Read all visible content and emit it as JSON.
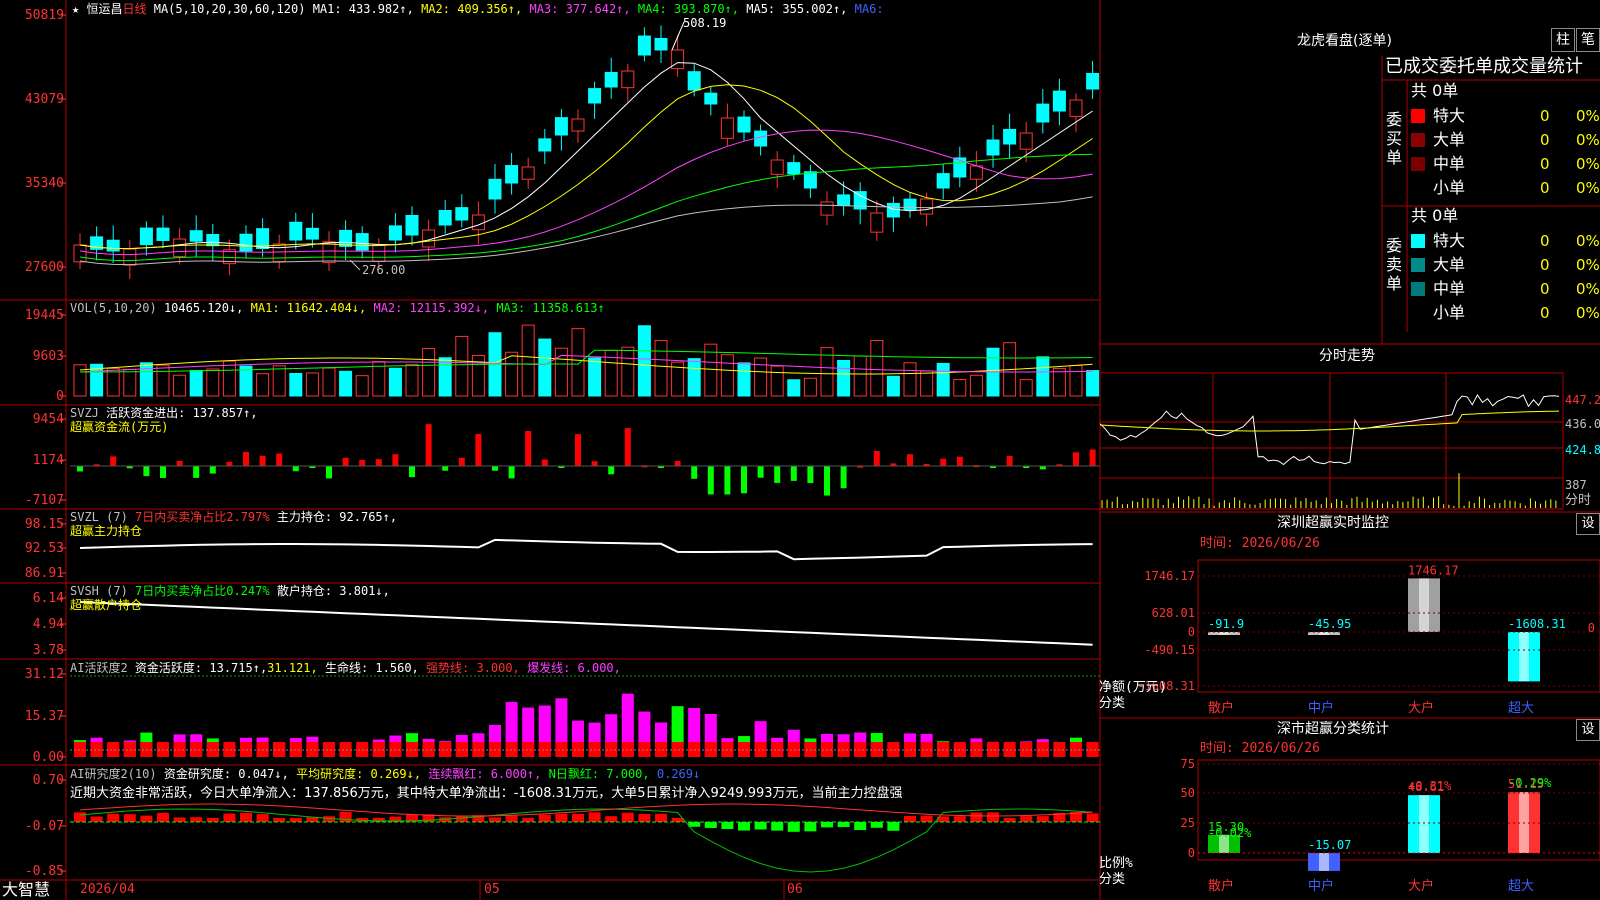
{
  "header": {
    "star": "★",
    "stock": "恒运昌",
    "period": "日线",
    "ma_title": "MA(5,10,20,30,60,120)",
    "ma1": "MA1: 433.982↑,",
    "ma2": "MA2: 409.356↑,",
    "ma3": "MA3: 377.642↑,",
    "ma4": "MA4: 393.870↑,",
    "ma5": "MA5: 355.002↑,",
    "ma6": "MA6:"
  },
  "price_axis": [
    "50819",
    "43079",
    "35340",
    "27600"
  ],
  "price_marks": {
    "high": "508.19",
    "low": "276.00"
  },
  "vol": {
    "title": "VOL(5,10,20)",
    "val": "10465.120↓,",
    "ma1": "MA1: 11642.404↓,",
    "ma2": "MA2: 12115.392↓,",
    "ma3": "MA3: 11358.613↑",
    "axis": [
      "19445",
      "9603",
      "0"
    ]
  },
  "svzj": {
    "title": "SVZJ",
    "label": "活跃资金进出: 137.857↑,",
    "sub": "超赢资金流(万元)",
    "axis": [
      "9454",
      "1174",
      "-7107"
    ]
  },
  "svzl": {
    "title": "SVZL (7)",
    "ratio": "7日内买卖净占比2.797%",
    "hold": "主力持仓: 92.765↑,",
    "sub": "超赢主力持仓",
    "axis": [
      "98.15",
      "92.53",
      "86.91"
    ]
  },
  "svsh": {
    "title": "SVSH (7)",
    "ratio": "7日内买卖净占比0.247%",
    "hold": "散户持仓: 3.801↓,",
    "sub": "超赢散户持仓",
    "axis": [
      "6.14",
      "4.94",
      "3.78"
    ]
  },
  "ai1": {
    "title": "AI活跃度2",
    "act": "资金活跃度: 13.715↑,",
    "v2": "31.121,",
    "life": "生命线: 1.560,",
    "strong": "强势线: 3.000,",
    "burst": "爆发线: 6.000,",
    "axis": [
      "31.12",
      "15.37",
      "0.00"
    ]
  },
  "ai2": {
    "title": "AI研究度2(10)",
    "res": "资金研究度: 0.047↓,",
    "avg": "平均研究度: 0.269↓,",
    "cont": "连续飘红: 6.000↑,",
    "nday": "N日飘红: 7.000,",
    "v5": "0.269↓",
    "summary": "近期大资金非常活跃，今日大单净流入：137.856万元，其中特大单净流出：-1608.31万元，大单5日累计净入9249.993万元，当前主力控盘强",
    "axis": [
      "0.70",
      "-0.07",
      "-0.85"
    ]
  },
  "bottom": {
    "brand": "大智慧",
    "date": "2026/04",
    "m5": "05",
    "m6": "06"
  },
  "dragon": {
    "title": "龙虎看盘(逐单)",
    "btn1": "柱",
    "btn2": "笔",
    "tab": "已成交委托单成交量统计",
    "buy_label": "委买单",
    "sell_label": "委卖单",
    "buy_total": "共 0单",
    "sell_total": "共 0单",
    "buy": [
      {
        "name": "特大",
        "n": "0",
        "p": "0%",
        "color": "#ff0000"
      },
      {
        "name": "大单",
        "n": "0",
        "p": "0%",
        "color": "#8b0000"
      },
      {
        "name": "中单",
        "n": "0",
        "p": "0%",
        "color": "#7a0000"
      },
      {
        "name": "小单",
        "n": "0",
        "p": "0%",
        "color": "#000000"
      }
    ],
    "sell": [
      {
        "name": "特大",
        "n": "0",
        "p": "0%",
        "color": "#00ffff"
      },
      {
        "name": "大单",
        "n": "0",
        "p": "0%",
        "color": "#008b8b"
      },
      {
        "name": "中单",
        "n": "0",
        "p": "0%",
        "color": "#007a7a"
      },
      {
        "name": "小单",
        "n": "0",
        "p": "0%",
        "color": "#000000"
      }
    ]
  },
  "intraday": {
    "title": "分时走势",
    "y": [
      "447.2",
      "436.0",
      "424.8"
    ],
    "vol": "387",
    "vol_label": "分时"
  },
  "monitor": {
    "title": "深圳超赢实时监控",
    "btn": "设",
    "time": "时间: 2026/06/26",
    "y_axis": [
      "1746.17",
      "628.01",
      "0",
      "-490.15",
      "-1608.31"
    ],
    "side": "净额(万元)",
    "side2": "分类",
    "chart_data": {
      "type": "bar",
      "categories": [
        "散户",
        "中户",
        "大户",
        "超大"
      ],
      "values": [
        -91.9,
        -45.95,
        1746.17,
        -1608.31
      ],
      "labels": [
        "-91.9",
        "-45.95",
        "1746.17",
        "-1608.31"
      ],
      "ylim": [
        -1608.31,
        1746.17
      ]
    }
  },
  "stats": {
    "title": "深市超赢分类统计",
    "btn": "设",
    "time": "时间: 2026/06/26",
    "y_axis": [
      "75",
      "50",
      "25",
      "0"
    ],
    "side": "比例%",
    "side2": "分类",
    "chart_data": {
      "type": "bar",
      "categories": [
        "散户",
        "中户",
        "大户",
        "超大"
      ],
      "values": [
        15.3,
        -15.07,
        48.61,
        51.15
      ],
      "changes": [
        "-0.02%",
        "",
        "+0.31%",
        "-0.29%"
      ],
      "labels": [
        "15.30",
        "-15.07",
        "48.61",
        "51.15"
      ],
      "ylim": [
        0,
        75
      ]
    }
  }
}
